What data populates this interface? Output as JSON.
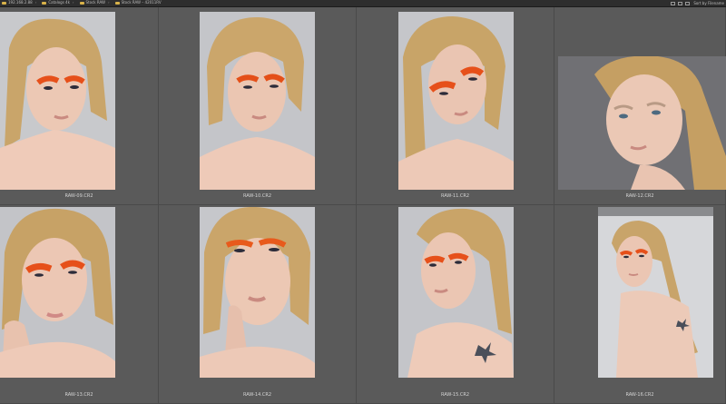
{
  "toolbar": {
    "breadcrumbs": [
      {
        "label": "192.168.2.88"
      },
      {
        "label": "Catalogs 4k"
      },
      {
        "label": "Stock RAW"
      },
      {
        "label": "Stock RAW – 42011RV"
      }
    ],
    "sort_label": "Sort by Filename",
    "icons": [
      "grid-view-icon",
      "list-view-icon",
      "zoom-icon"
    ]
  },
  "thumbnails": [
    {
      "filename": "RAW-09.CR2",
      "orientation": "portrait"
    },
    {
      "filename": "RAW-10.CR2",
      "orientation": "portrait"
    },
    {
      "filename": "RAW-11.CR2",
      "orientation": "portrait"
    },
    {
      "filename": "RAW-12.CR2",
      "orientation": "landscape"
    },
    {
      "filename": "RAW-13.CR2",
      "orientation": "portrait"
    },
    {
      "filename": "RAW-14.CR2",
      "orientation": "portrait"
    },
    {
      "filename": "RAW-15.CR2",
      "orientation": "portrait"
    },
    {
      "filename": "RAW-16.CR2",
      "orientation": "portrait"
    }
  ],
  "colors": {
    "background": "#5a5a5a",
    "topbar": "#2e2e2e",
    "caption": "#d4d4d4",
    "folder": "#d8b24a"
  }
}
